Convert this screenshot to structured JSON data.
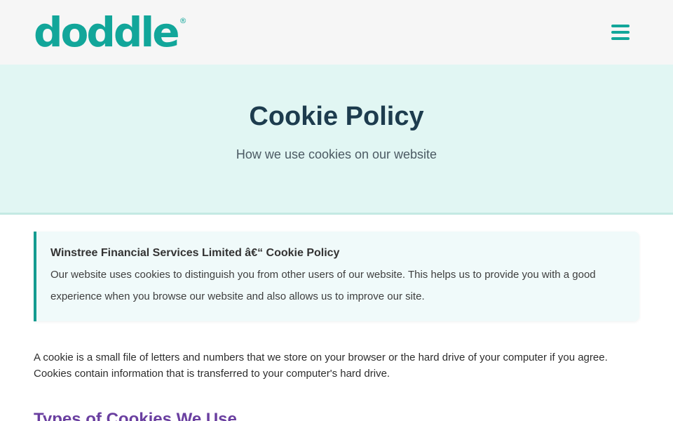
{
  "header": {
    "logo_text": "doddle",
    "logo_mark": "®",
    "menu_icon": "hamburger-menu-icon",
    "brand_color": "#12a69a"
  },
  "hero": {
    "title": "Cookie Policy",
    "subtitle": "How we use cookies on our website",
    "background": "#e1f6f3"
  },
  "notice": {
    "title": "Winstree Financial Services Limited â€“ Cookie Policy",
    "body": "Our website uses cookies to distinguish you from other users of our website. This helps us to provide you with a good experience when you browse our website and also allows us to improve our site.",
    "accent": "#139c90"
  },
  "content": {
    "intro": "A cookie is a small file of letters and numbers that we store on your browser or the hard drive of your computer if you agree. Cookies contain information that is transferred to your computer's hard drive.",
    "section_heading": "Types of Cookies We Use",
    "heading_color": "#6a3fa0"
  }
}
